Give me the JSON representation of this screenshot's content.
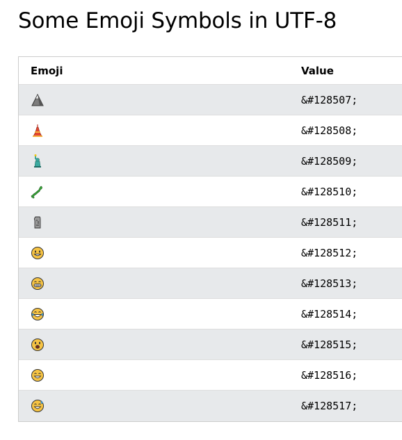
{
  "title": "Some Emoji Symbols in UTF-8",
  "table": {
    "headers": {
      "emoji": "Emoji",
      "value": "Value"
    },
    "rows": [
      {
        "icon": "mount-fuji-icon",
        "value": "&#128507;"
      },
      {
        "icon": "tokyo-tower-icon",
        "value": "&#128508;"
      },
      {
        "icon": "statue-of-liberty-icon",
        "value": "&#128509;"
      },
      {
        "icon": "map-of-japan-icon",
        "value": "&#128510;"
      },
      {
        "icon": "moai-icon",
        "value": "&#128511;"
      },
      {
        "icon": "grinning-face-icon",
        "value": "&#128512;"
      },
      {
        "icon": "grinning-face-with-smiling-eyes-icon",
        "value": "&#128513;"
      },
      {
        "icon": "face-with-tears-of-joy-icon",
        "value": "&#128514;"
      },
      {
        "icon": "smiling-face-with-open-mouth-icon",
        "value": "&#128515;"
      },
      {
        "icon": "smiling-face-with-open-mouth-and-smiling-eyes-icon",
        "value": "&#128516;"
      },
      {
        "icon": "smiling-face-with-open-mouth-and-cold-sweat-icon",
        "value": "&#128517;"
      }
    ]
  }
}
